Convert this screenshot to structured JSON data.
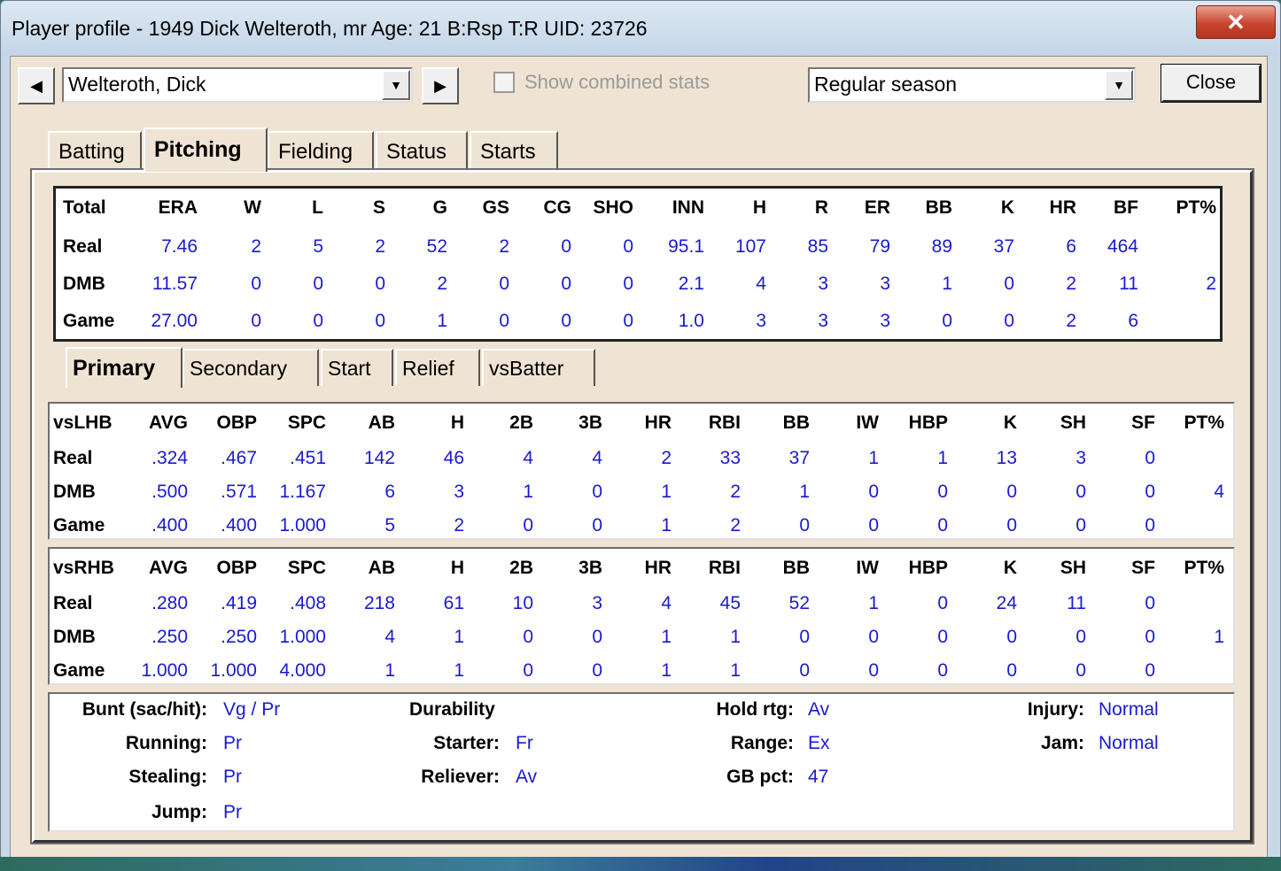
{
  "window": {
    "title": "Player profile - 1949 Dick Welteroth, mr  Age: 21  B:Rsp T:R  UID: 23726",
    "close_glyph": "✕"
  },
  "toolbar": {
    "prev_glyph": "◀",
    "next_glyph": "▶",
    "player_select": "Welteroth, Dick",
    "show_combined_label": "Show combined stats",
    "season_select": "Regular season",
    "close_label": "Close",
    "dropdown_glyph": "▼"
  },
  "tabs": [
    "Batting",
    "Pitching",
    "Fielding",
    "Status",
    "Starts"
  ],
  "total": {
    "headers": [
      "Total",
      "ERA",
      "W",
      "L",
      "S",
      "G",
      "GS",
      "CG",
      "SHO",
      "INN",
      "H",
      "R",
      "ER",
      "BB",
      "K",
      "HR",
      "BF",
      "PT%"
    ],
    "rows": [
      [
        "Real",
        "7.46",
        "2",
        "5",
        "2",
        "52",
        "2",
        "0",
        "0",
        "95.1",
        "107",
        "85",
        "79",
        "89",
        "37",
        "6",
        "464",
        ""
      ],
      [
        "DMB",
        "11.57",
        "0",
        "0",
        "0",
        "2",
        "0",
        "0",
        "0",
        "2.1",
        "4",
        "3",
        "3",
        "1",
        "0",
        "2",
        "11",
        "2"
      ],
      [
        "Game",
        "27.00",
        "0",
        "0",
        "0",
        "1",
        "0",
        "0",
        "0",
        "1.0",
        "3",
        "3",
        "3",
        "0",
        "0",
        "2",
        "6",
        ""
      ]
    ]
  },
  "subtabs": [
    "Primary",
    "Secondary",
    "Start",
    "Relief",
    "vsBatter"
  ],
  "vslhb": {
    "headers": [
      "vsLHB",
      "AVG",
      "OBP",
      "SPC",
      "AB",
      "H",
      "2B",
      "3B",
      "HR",
      "RBI",
      "BB",
      "IW",
      "HBP",
      "K",
      "SH",
      "SF",
      "PT%"
    ],
    "rows": [
      [
        "Real",
        ".324",
        ".467",
        ".451",
        "142",
        "46",
        "4",
        "4",
        "2",
        "33",
        "37",
        "1",
        "1",
        "13",
        "3",
        "0",
        ""
      ],
      [
        "DMB",
        ".500",
        ".571",
        "1.167",
        "6",
        "3",
        "1",
        "0",
        "1",
        "2",
        "1",
        "0",
        "0",
        "0",
        "0",
        "0",
        "4"
      ],
      [
        "Game",
        ".400",
        ".400",
        "1.000",
        "5",
        "2",
        "0",
        "0",
        "1",
        "2",
        "0",
        "0",
        "0",
        "0",
        "0",
        "0",
        ""
      ]
    ]
  },
  "vsrhb": {
    "headers": [
      "vsRHB",
      "AVG",
      "OBP",
      "SPC",
      "AB",
      "H",
      "2B",
      "3B",
      "HR",
      "RBI",
      "BB",
      "IW",
      "HBP",
      "K",
      "SH",
      "SF",
      "PT%"
    ],
    "rows": [
      [
        "Real",
        ".280",
        ".419",
        ".408",
        "218",
        "61",
        "10",
        "3",
        "4",
        "45",
        "52",
        "1",
        "0",
        "24",
        "11",
        "0",
        ""
      ],
      [
        "DMB",
        ".250",
        ".250",
        "1.000",
        "4",
        "1",
        "0",
        "0",
        "1",
        "1",
        "0",
        "0",
        "0",
        "0",
        "0",
        "0",
        "1"
      ],
      [
        "Game",
        "1.000",
        "1.000",
        "4.000",
        "1",
        "1",
        "0",
        "0",
        "1",
        "1",
        "0",
        "0",
        "0",
        "0",
        "0",
        "0",
        ""
      ]
    ]
  },
  "attributes": {
    "bunt_label": "Bunt (sac/hit):",
    "bunt": "Vg / Pr",
    "running_label": "Running:",
    "running": "Pr",
    "stealing_label": "Stealing:",
    "stealing": "Pr",
    "jump_label": "Jump:",
    "jump": "Pr",
    "durability_label": "Durability",
    "starter_label": "Starter:",
    "starter": "Fr",
    "reliever_label": "Reliever:",
    "reliever": "Av",
    "hold_label": "Hold rtg:",
    "hold": "Av",
    "range_label": "Range:",
    "range": "Ex",
    "gb_label": "GB pct:",
    "gb": "47",
    "injury_label": "Injury:",
    "injury": "Normal",
    "jam_label": "Jam:",
    "jam": "Normal"
  }
}
